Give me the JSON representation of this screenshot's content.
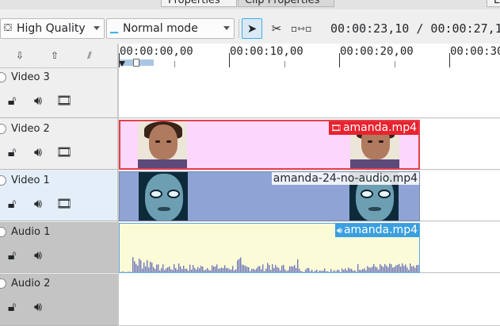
{
  "tabs": [
    {
      "label": "Properties"
    },
    {
      "label": "Clip Properties"
    },
    {
      "label": "E"
    }
  ],
  "toolbar": {
    "quality": {
      "label": "High Quality",
      "icon": "preview-quality-icon"
    },
    "mode": {
      "label": "Normal mode",
      "icon": "edit-mode-icon"
    },
    "timecode": "00:00:23,10 / 00:00:27,1"
  },
  "ruler": {
    "labels": [
      "00:00:00,00",
      "00:00:10,00",
      "00:00:20,00",
      "00:00:30"
    ]
  },
  "tracks": [
    {
      "name": "Video 3",
      "kind": "video"
    },
    {
      "name": "Video 2",
      "kind": "video"
    },
    {
      "name": "Video 1",
      "kind": "video"
    },
    {
      "name": "Audio 1",
      "kind": "audio"
    },
    {
      "name": "Audio 2",
      "kind": "audio"
    }
  ],
  "clips": {
    "video2": {
      "label": "amanda.mp4",
      "color": "#e8232f"
    },
    "video1": {
      "label": "amanda-24-no-audio.mp4"
    },
    "audio1": {
      "label": "amanda.mp4",
      "color": "#3a9fe0"
    }
  },
  "colors": {
    "accent": "#3daee9",
    "clip_pink": "#fdd6fb",
    "clip_blue": "#8fa4d5",
    "clip_audio": "#fbfbd8",
    "waveform": "#6f78b8"
  }
}
